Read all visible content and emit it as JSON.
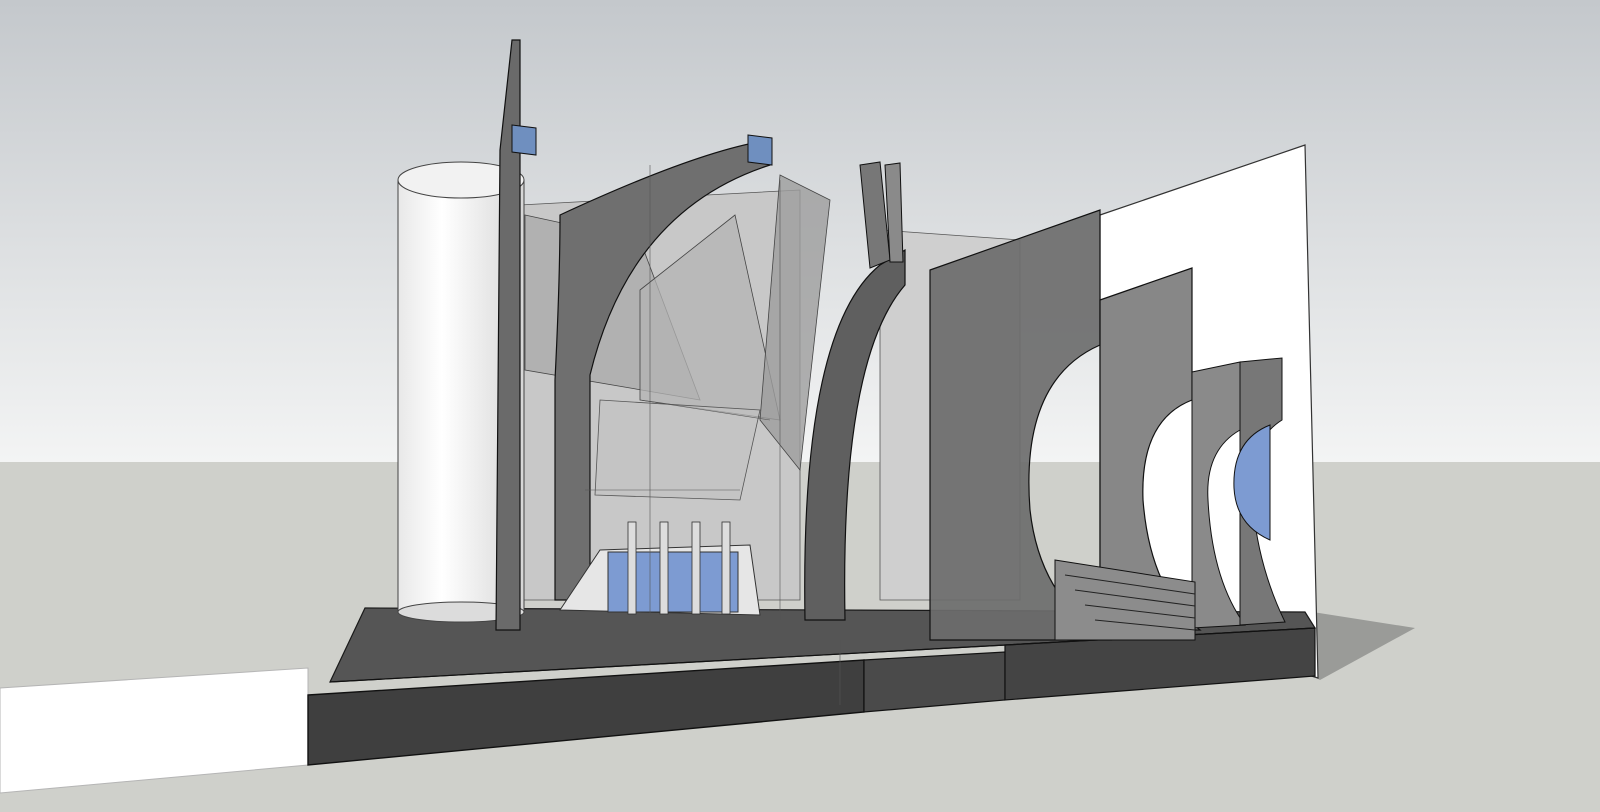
{
  "viewport": {
    "sky_top": "#c4c8cc",
    "sky_bottom": "#f3f4f4",
    "ground": "#cfd0cb",
    "shadow": "#9a9b98",
    "edge": "#1a1a1a",
    "glass": "#7d9bd2",
    "wall_dark": "#4d4d4d",
    "wall_mid": "#8a8a8a",
    "wall_light": "#bdbdbd",
    "white": "#ffffff"
  }
}
